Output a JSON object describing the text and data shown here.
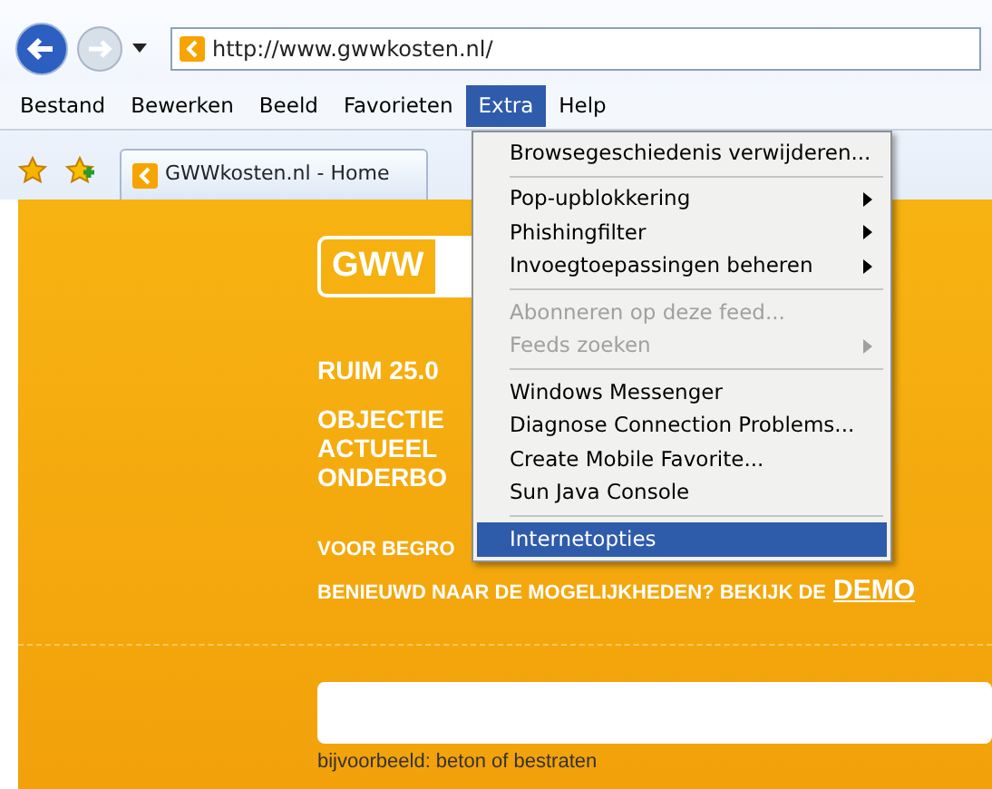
{
  "nav": {
    "address": "http://www.gwwkosten.nl/"
  },
  "menubar": [
    {
      "label": "Bestand",
      "selected": false
    },
    {
      "label": "Bewerken",
      "selected": false
    },
    {
      "label": "Beeld",
      "selected": false
    },
    {
      "label": "Favorieten",
      "selected": false
    },
    {
      "label": "Extra",
      "selected": true
    },
    {
      "label": "Help",
      "selected": false
    }
  ],
  "tab": {
    "title": "GWWkosten.nl - Home"
  },
  "menu": [
    {
      "kind": "item",
      "label": "Browsegeschiedenis verwijderen...",
      "submenu": false,
      "disabled": false,
      "selected": false
    },
    {
      "kind": "separator"
    },
    {
      "kind": "item",
      "label": "Pop-upblokkering",
      "submenu": true,
      "disabled": false,
      "selected": false
    },
    {
      "kind": "item",
      "label": "Phishingfilter",
      "submenu": true,
      "disabled": false,
      "selected": false
    },
    {
      "kind": "item",
      "label": "Invoegtoepassingen beheren",
      "submenu": true,
      "disabled": false,
      "selected": false
    },
    {
      "kind": "separator"
    },
    {
      "kind": "item",
      "label": "Abonneren op deze feed...",
      "submenu": false,
      "disabled": true,
      "selected": false
    },
    {
      "kind": "item",
      "label": "Feeds zoeken",
      "submenu": true,
      "disabled": true,
      "selected": false
    },
    {
      "kind": "separator"
    },
    {
      "kind": "item",
      "label": "Windows Messenger",
      "submenu": false,
      "disabled": false,
      "selected": false
    },
    {
      "kind": "item",
      "label": "Diagnose Connection Problems...",
      "submenu": false,
      "disabled": false,
      "selected": false
    },
    {
      "kind": "item",
      "label": "Create Mobile Favorite...",
      "submenu": false,
      "disabled": false,
      "selected": false
    },
    {
      "kind": "item",
      "label": "Sun Java Console",
      "submenu": false,
      "disabled": false,
      "selected": false
    },
    {
      "kind": "separator"
    },
    {
      "kind": "item",
      "label": "Internetopties",
      "submenu": false,
      "disabled": false,
      "selected": true
    }
  ],
  "page": {
    "logo": "GWW",
    "headline": "RUIM 25.0",
    "lines": [
      "OBJECTIE",
      "ACTUEEL",
      "ONDERBO"
    ],
    "intro": "VOOR BEGRO",
    "cta": "BENIEUWD NAAR DE MOGELIJKHEDEN? BEKIJK DE",
    "cta_link": "DEMO",
    "search_hint": "bijvoorbeeld: beton of bestraten"
  }
}
